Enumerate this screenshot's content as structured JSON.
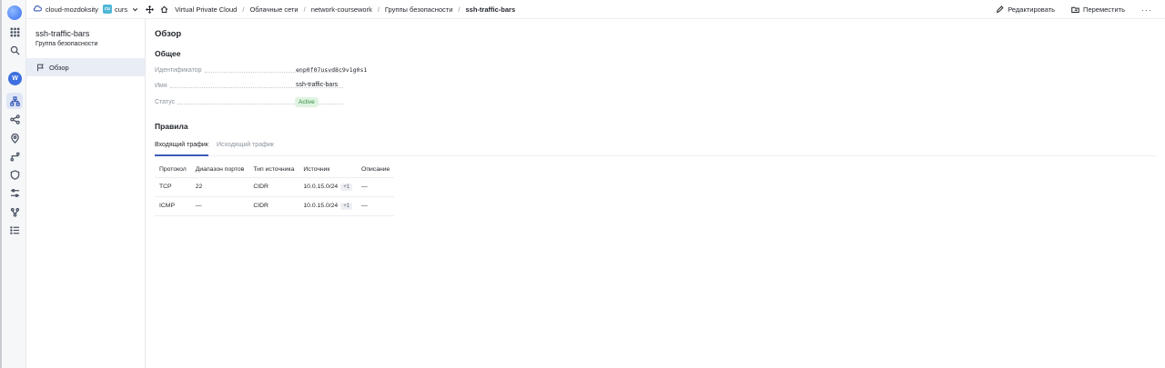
{
  "rail": {
    "avatar_letter": "W"
  },
  "breadcrumb": {
    "cloud": "cloud-mozdoksity",
    "folder_badge": "cu",
    "folder": "curs",
    "items": [
      "Virtual Private Cloud",
      "Облачные сети",
      "network-coursework",
      "Группы безопасности",
      "ssh-traffic-bars"
    ],
    "separator": "/"
  },
  "actions": {
    "edit": "Редактировать",
    "move": "Переместить",
    "more": "···"
  },
  "side": {
    "title": "ssh-traffic-bars",
    "subtitle": "Группа безопасности",
    "nav_overview": "Обзор"
  },
  "main": {
    "heading": "Обзор",
    "general": "Общее",
    "props": {
      "id_label": "Идентификатор",
      "id_value": "enp0f07usvd8c9v1g0s1",
      "name_label": "Имя",
      "name_value": "ssh-traffic-bars",
      "status_label": "Статус",
      "status_value": "Active"
    },
    "rules_heading": "Правила",
    "tabs": {
      "ingress": "Входящий трафик",
      "egress": "Исходящий трафик"
    },
    "table": {
      "headers": [
        "Протокол",
        "Диапазон портов",
        "Тип источника",
        "Источник",
        "Описание"
      ],
      "rows": [
        {
          "protocol": "TCP",
          "ports": "22",
          "source_type": "CIDR",
          "source": "10.0.15.0/24",
          "extra": "+1",
          "description": "—"
        },
        {
          "protocol": "ICMP",
          "ports": "—",
          "source_type": "CIDR",
          "source": "10.0.15.0/24",
          "extra": "+1",
          "description": "—"
        }
      ]
    }
  },
  "colors": {
    "accent": "#3a5bb8",
    "status_bg": "#dff3e1",
    "status_fg": "#2f8a3f"
  }
}
